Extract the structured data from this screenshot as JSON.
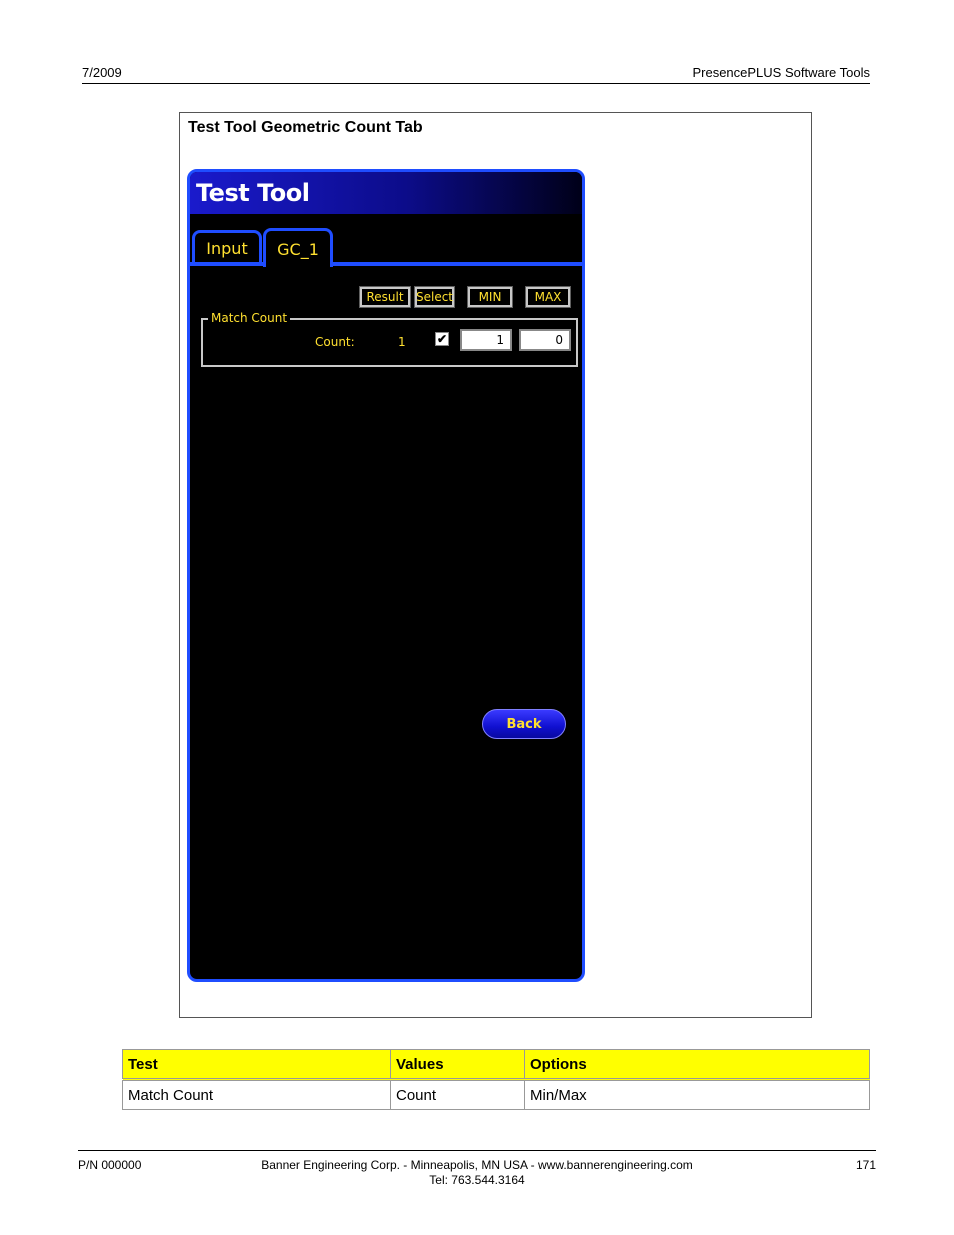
{
  "header": {
    "date": "7/2009",
    "title": "PresencePLUS Software Tools"
  },
  "figure": {
    "caption": "Test Tool Geometric Count Tab"
  },
  "screen": {
    "title": "Test Tool",
    "tabs": [
      {
        "label": "Input"
      },
      {
        "label": "GC_1",
        "active": true
      }
    ],
    "column_buttons": {
      "result": "Result",
      "select": "Select",
      "min": "MIN",
      "max": "MAX"
    },
    "group": {
      "legend": "Match Count",
      "label": "Count:",
      "result": "1",
      "selected": true,
      "checkmark": "✔",
      "min_value": "1",
      "max_value": "0"
    },
    "back_label": "Back",
    "colors": {
      "accent": "#1f4dff",
      "label_text": "#ffe030",
      "background": "#000000"
    }
  },
  "table": {
    "headers": [
      "Test",
      "Values",
      "Options"
    ],
    "rows": [
      [
        "Match Count",
        "Count",
        "Min/Max"
      ]
    ],
    "header_color": "#ffff00"
  },
  "footer": {
    "part_number": "P/N 000000",
    "company_line": "Banner Engineering Corp. - Minneapolis, MN USA - www.bannerengineering.com",
    "phone": "Tel: 763.544.3164",
    "page": "171"
  }
}
